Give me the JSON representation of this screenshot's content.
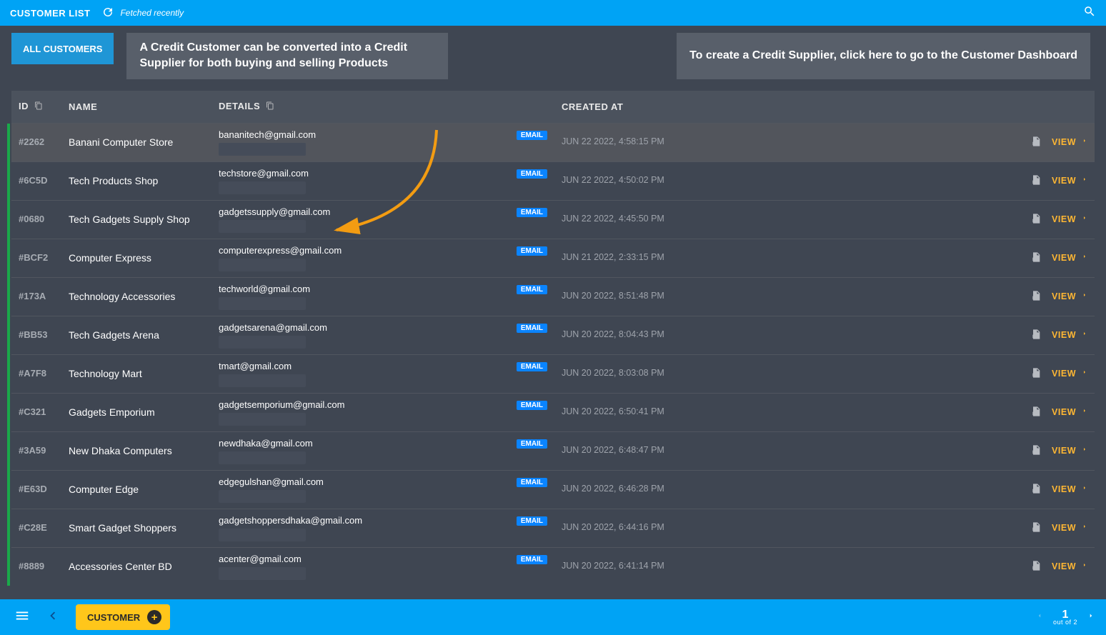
{
  "topbar": {
    "title": "CUSTOMER LIST",
    "fetched": "Fetched recently"
  },
  "tabs": {
    "all": "ALL CUSTOMERS"
  },
  "callouts": {
    "c1": "A Credit Customer can be converted into a Credit Supplier for both buying and selling Products",
    "c2": "To create a Credit Supplier, click here to go to the Customer Dashboard"
  },
  "columns": {
    "id": "ID",
    "name": "NAME",
    "details": "DETAILS",
    "created": "CREATED AT"
  },
  "badge_email": "EMAIL",
  "view_label": "VIEW",
  "rows": [
    {
      "id": "#2262",
      "name": "Banani Computer Store",
      "email": "bananitech@gmail.com",
      "created": "JUN 22 2022, 4:58:15 PM",
      "highlight": true
    },
    {
      "id": "#6C5D",
      "name": "Tech Products Shop",
      "email": "techstore@gmail.com",
      "created": "JUN 22 2022, 4:50:02 PM"
    },
    {
      "id": "#0680",
      "name": "Tech Gadgets Supply Shop",
      "email": "gadgetssupply@gmail.com",
      "created": "JUN 22 2022, 4:45:50 PM"
    },
    {
      "id": "#BCF2",
      "name": "Computer Express",
      "email": "computerexpress@gmail.com",
      "created": "JUN 21 2022, 2:33:15 PM"
    },
    {
      "id": "#173A",
      "name": "Technology Accessories",
      "email": "techworld@gmail.com",
      "created": "JUN 20 2022, 8:51:48 PM"
    },
    {
      "id": "#BB53",
      "name": "Tech Gadgets Arena",
      "email": "gadgetsarena@gmail.com",
      "created": "JUN 20 2022, 8:04:43 PM"
    },
    {
      "id": "#A7F8",
      "name": "Technology Mart",
      "email": "tmart@gmail.com",
      "created": "JUN 20 2022, 8:03:08 PM"
    },
    {
      "id": "#C321",
      "name": "Gadgets Emporium",
      "email": "gadgetsemporium@gmail.com",
      "created": "JUN 20 2022, 6:50:41 PM"
    },
    {
      "id": "#3A59",
      "name": "New Dhaka Computers",
      "email": "newdhaka@gmail.com",
      "created": "JUN 20 2022, 6:48:47 PM"
    },
    {
      "id": "#E63D",
      "name": "Computer Edge",
      "email": "edgegulshan@gmail.com",
      "created": "JUN 20 2022, 6:46:28 PM"
    },
    {
      "id": "#C28E",
      "name": "Smart Gadget Shoppers",
      "email": "gadgetshoppersdhaka@gmail.com",
      "created": "JUN 20 2022, 6:44:16 PM"
    },
    {
      "id": "#8889",
      "name": "Accessories Center BD",
      "email": "acenter@gmail.com",
      "created": "JUN 20 2022, 6:41:14 PM"
    }
  ],
  "bottom": {
    "customer_btn": "CUSTOMER",
    "page": "1",
    "page_sub": "out of 2"
  }
}
